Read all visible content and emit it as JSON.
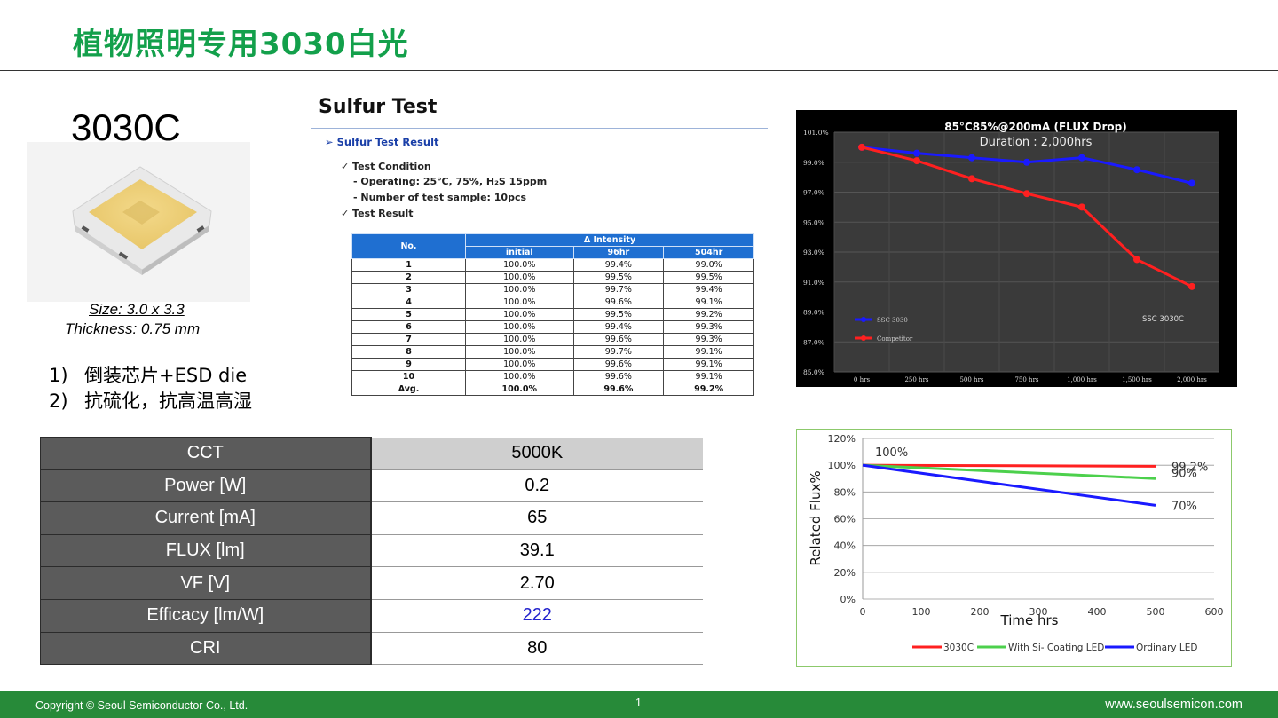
{
  "slide_title": "植物照明专用3030白光",
  "product": {
    "name": "3030C",
    "size": "Size: 3.0 x 3.3",
    "thickness": "Thickness: 0.75 mm",
    "features": [
      {
        "num": "1)",
        "text": "倒装芯片+ESD die"
      },
      {
        "num": "2)",
        "text": "抗硫化，抗高温高湿"
      }
    ]
  },
  "sulfur": {
    "title": "Sulfur Test",
    "result_heading": "➢  Sulfur Test Result",
    "conditions": [
      "✓ Test Condition",
      "- Operating: 25℃, 75%, H₂S 15ppm",
      "- Number of test sample: 10pcs",
      "✓  Test Result"
    ],
    "table": {
      "col_no": "No.",
      "col_group": "Δ Intensity",
      "cols": [
        "initial",
        "96hr",
        "504hr"
      ],
      "rows": [
        [
          "1",
          "100.0%",
          "99.4%",
          "99.0%"
        ],
        [
          "2",
          "100.0%",
          "99.5%",
          "99.5%"
        ],
        [
          "3",
          "100.0%",
          "99.7%",
          "99.4%"
        ],
        [
          "4",
          "100.0%",
          "99.6%",
          "99.1%"
        ],
        [
          "5",
          "100.0%",
          "99.5%",
          "99.2%"
        ],
        [
          "6",
          "100.0%",
          "99.4%",
          "99.3%"
        ],
        [
          "7",
          "100.0%",
          "99.6%",
          "99.3%"
        ],
        [
          "8",
          "100.0%",
          "99.7%",
          "99.1%"
        ],
        [
          "9",
          "100.0%",
          "99.6%",
          "99.1%"
        ],
        [
          "10",
          "100.0%",
          "99.6%",
          "99.1%"
        ],
        [
          "Avg.",
          "100.0%",
          "99.6%",
          "99.2%"
        ]
      ]
    }
  },
  "specs": [
    {
      "label": "CCT",
      "value": "5000K"
    },
    {
      "label": "Power  [W]",
      "value": "0.2"
    },
    {
      "label": "Current  [mA]",
      "value": "65"
    },
    {
      "label": "FLUX [lm]",
      "value": "39.1"
    },
    {
      "label": "VF [V]",
      "value": "2.70"
    },
    {
      "label": "Efficacy [lm/W]",
      "value": "222"
    },
    {
      "label": "CRI",
      "value": "80"
    }
  ],
  "colors": {
    "title_green": "#13a04b",
    "footer_green": "#278a39",
    "table_blue": "#1f6fd1",
    "series_blue": "#1a1aff",
    "series_red": "#ff2020",
    "series_green": "#4cd04c"
  },
  "footer": {
    "copyright": "Copyright © Seoul Semiconductor Co., Ltd.",
    "page": "1",
    "url": "www.seoulsemicon.com"
  },
  "chart_data": [
    {
      "type": "line",
      "title": "85°C85%@200mA (FLUX Drop)",
      "subtitle": "Duration : 2,000hrs",
      "categories": [
        "0 hrs",
        "250 hrs",
        "500 hrs",
        "750 hrs",
        "1,000 hrs",
        "1,500 hrs",
        "2,000 hrs"
      ],
      "y_ticks": [
        "101.0%",
        "99.0%",
        "97.0%",
        "95.0%",
        "93.0%",
        "91.0%",
        "89.0%",
        "87.0%",
        "85.0%"
      ],
      "ylim": [
        85,
        101
      ],
      "series": [
        {
          "name": "SSC 3030",
          "color": "#1a1aff",
          "values": [
            100.0,
            99.6,
            99.3,
            99.0,
            99.3,
            98.5,
            97.6
          ]
        },
        {
          "name": "Competitor",
          "color": "#ff2020",
          "values": [
            100.0,
            99.1,
            97.9,
            96.9,
            96.0,
            92.5,
            90.7
          ]
        }
      ],
      "annotation": "SSC 3030C",
      "legend_position": "bottom-left",
      "grid": true
    },
    {
      "type": "line",
      "xlabel": "Time hrs",
      "ylabel": "Related Flux%",
      "x_ticks": [
        "0",
        "100",
        "200",
        "300",
        "400",
        "500",
        "600"
      ],
      "y_ticks": [
        "0%",
        "20%",
        "40%",
        "60%",
        "80%",
        "100%",
        "120%"
      ],
      "xlim": [
        0,
        600
      ],
      "ylim": [
        0,
        120
      ],
      "series": [
        {
          "name": "3030C",
          "color": "#ff2020",
          "points": [
            [
              0,
              100
            ],
            [
              500,
              99.2
            ]
          ],
          "end_label": "99.2%"
        },
        {
          "name": "With Si- Coating LED",
          "color": "#4cd04c",
          "points": [
            [
              0,
              100
            ],
            [
              500,
              90
            ]
          ],
          "end_label": "90%"
        },
        {
          "name": "Ordinary LED",
          "color": "#1a1aff",
          "points": [
            [
              0,
              100
            ],
            [
              500,
              70
            ]
          ],
          "end_label": "70%"
        }
      ],
      "start_label": "100%",
      "legend_position": "bottom",
      "grid": true
    }
  ]
}
